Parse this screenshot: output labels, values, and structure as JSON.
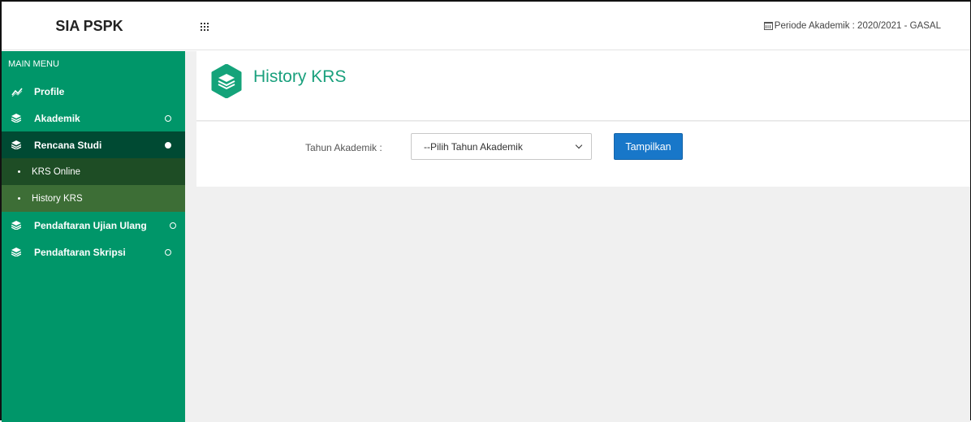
{
  "header": {
    "brand": "SIA PSPK",
    "periode": "Periode Akademik : 2020/2021 - GASAL"
  },
  "sidebar": {
    "section_title": "MAIN MENU",
    "items": [
      {
        "label": "Profile",
        "icon": "chart-line-icon"
      },
      {
        "label": "Akademik",
        "icon": "layers-icon"
      },
      {
        "label": "Rencana Studi",
        "icon": "layers-icon",
        "expanded": true
      },
      {
        "label": "Pendaftaran Ujian Ulang",
        "icon": "layers-icon"
      },
      {
        "label": "Pendaftaran Skripsi",
        "icon": "layers-icon"
      }
    ],
    "sub_items": [
      {
        "label": "KRS Online"
      },
      {
        "label": "History KRS",
        "active": true
      }
    ]
  },
  "main": {
    "title": "History KRS",
    "filter": {
      "label": "Tahun Akademik :",
      "select_value": "--Pilih Tahun Akademik",
      "button_label": "Tampilkan"
    }
  },
  "colors": {
    "sidebar_bg": "#009669",
    "active_item_bg": "#004a33",
    "title_color": "#1aa07d",
    "button_bg": "#1877c9"
  }
}
